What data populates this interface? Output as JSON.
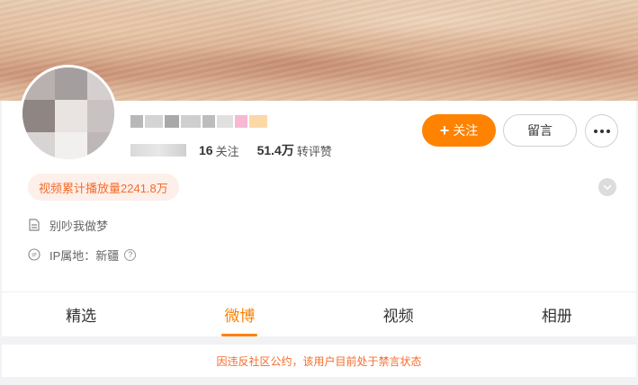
{
  "profile": {
    "stats": [
      {
        "num": "16",
        "label": "关注"
      },
      {
        "num": "51.4万",
        "label": "转评赞"
      }
    ],
    "follow_label": "关注",
    "message_label": "留言",
    "more_icon": "more-dots-icon",
    "video_badge": "视频累计播放量2241.8万",
    "bio": "别吵我做梦",
    "ip_location": "IP属地：新疆",
    "help_icon": "question-icon"
  },
  "tabs": [
    {
      "label": "精选",
      "active": false
    },
    {
      "label": "微博",
      "active": true
    },
    {
      "label": "视频",
      "active": false
    },
    {
      "label": "相册",
      "active": false
    }
  ],
  "notice": "因违反社区公约，该用户目前处于禁言状态",
  "colors": {
    "accent": "#ff8200",
    "badge_text": "#f56b2a",
    "badge_bg": "#fdefe9"
  }
}
